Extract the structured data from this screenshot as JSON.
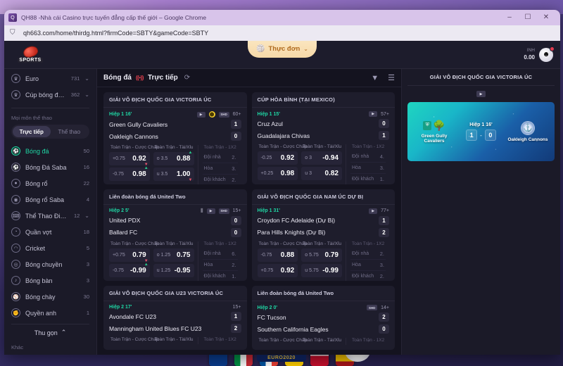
{
  "window": {
    "title": "QH88 -Nhà cái Casino trực tuyến đẳng cấp thế giới – Google Chrome",
    "favicon_icon": "site-favicon",
    "minimize_icon": "–",
    "maximize_icon": "☐",
    "close_icon": "✕",
    "address": {
      "url": "qh663.com/home/thirdg.html?firmCode=SBTY&gameCode=SBTY",
      "security_icon": "page-info-icon"
    }
  },
  "header": {
    "logo_text": "SPORTS",
    "logo_icon": "red-ball-icon",
    "menu": {
      "label": "Thực đơn",
      "icon": "menu-ball-icon",
      "caret": "⌄"
    },
    "balance": {
      "label": "INH",
      "value": "0.00",
      "avatar_icon": "user-avatar-icon",
      "notification_dot": true
    }
  },
  "sidebar": {
    "top_items": [
      {
        "label": "Euro",
        "count": "731",
        "icon": "trophy-icon",
        "caret": "⌄",
        "expandable": true
      },
      {
        "label": "Cúp bóng đá Na...",
        "count": "362",
        "icon": "trophy-icon",
        "caret": "⌄",
        "expandable": true
      }
    ],
    "section_label": "Mọi môn thể thao",
    "segmented": {
      "options": [
        "Trực tiếp",
        "Thể thao"
      ],
      "selected": "Trực tiếp"
    },
    "sports": [
      {
        "label": "Bóng đá",
        "count": "50",
        "icon": "soccer-ball-icon",
        "active": true,
        "caret": ""
      },
      {
        "label": "Bóng Đá Saba",
        "count": "16",
        "icon": "soccer-saba-icon",
        "active": false,
        "caret": ""
      },
      {
        "label": "Bóng rổ",
        "count": "22",
        "icon": "basketball-icon",
        "active": false,
        "caret": ""
      },
      {
        "label": "Bóng rổ Saba",
        "count": "4",
        "icon": "basketball-saba-icon",
        "active": false,
        "caret": ""
      },
      {
        "label": "Thể Thao Điện Tử",
        "count": "12",
        "icon": "esports-icon",
        "active": false,
        "caret": "⌄"
      },
      {
        "label": "Quần vợt",
        "count": "18",
        "icon": "tennis-icon",
        "active": false,
        "caret": ""
      },
      {
        "label": "Cricket",
        "count": "5",
        "icon": "cricket-icon",
        "active": false,
        "caret": ""
      },
      {
        "label": "Bóng chuyền",
        "count": "3",
        "icon": "volleyball-icon",
        "active": false,
        "caret": ""
      },
      {
        "label": "Bóng bàn",
        "count": "3",
        "icon": "table-tennis-icon",
        "active": false,
        "caret": ""
      },
      {
        "label": "Bóng chày",
        "count": "30",
        "icon": "baseball-icon",
        "active": false,
        "caret": ""
      },
      {
        "label": "Quyền anh",
        "count": "1",
        "icon": "boxing-icon",
        "active": false,
        "caret": ""
      }
    ],
    "collapse": {
      "label": "Thu gọn",
      "caret": "⌃"
    },
    "other_label": "Khác"
  },
  "main": {
    "title": "Bóng đá",
    "live_badge": "((•))",
    "live_label": "Trực tiếp",
    "refresh_icon": "refresh-icon",
    "filter_icon": "filter-icon",
    "list_icon": "list-view-icon",
    "odds_headers": {
      "handicap": "Toàn Trận - Cược Chấp",
      "overunder": "Toàn Trận - Tài/Xỉu",
      "onextwo": "Toàn Trận - 1X2"
    },
    "onextwo_rows": [
      "Đội nhà",
      "Hòa",
      "Đội khách"
    ],
    "matches": [
      {
        "league": "GIẢI VÔ ĐỊCH QUỐC GIA VICTORIA ÚC",
        "period": "Hiệp 1 16'",
        "time": "60+",
        "icons": [
          "tv-icon",
          "ball-icon",
          "shd-icon"
        ],
        "home": {
          "name": "Green Gully Cavaliers",
          "score": "1"
        },
        "away": {
          "name": "Oakleigh Cannons",
          "score": "0"
        },
        "handicap": [
          {
            "cap": "+0.75",
            "odds": "0.92",
            "arrow": "down"
          },
          {
            "cap": "-0.75",
            "odds": "0.98",
            "arrow": "up"
          }
        ],
        "overunder": [
          {
            "cap": "o 3.5",
            "odds": "0.88",
            "arrow": "up"
          },
          {
            "cap": "u 3.5",
            "odds": "1.00",
            "arrow": "down"
          }
        ],
        "onextwo": [
          "2.",
          "3.",
          "2."
        ]
      },
      {
        "league": "CÚP HÒA BÌNH (TẠI MEXICO)",
        "period": "Hiệp 1 15'",
        "time": "57+",
        "icons": [
          "tv-icon"
        ],
        "home": {
          "name": "Cruz Azul",
          "score": "0"
        },
        "away": {
          "name": "Guadalajara Chivas",
          "score": "1"
        },
        "handicap": [
          {
            "cap": "-0.25",
            "odds": "0.92",
            "arrow": ""
          },
          {
            "cap": "+0.25",
            "odds": "0.98",
            "arrow": ""
          }
        ],
        "overunder": [
          {
            "cap": "o 3",
            "odds": "-0.94",
            "arrow": ""
          },
          {
            "cap": "u 3",
            "odds": "0.82",
            "arrow": ""
          }
        ],
        "onextwo": [
          "4.",
          "3.",
          "1."
        ]
      },
      {
        "league": "Liên đoàn bóng đá United Two",
        "period": "Hiệp 2 5'",
        "time": "15+",
        "icons": [
          "stats-icon",
          "tv-icon",
          "shd-icon"
        ],
        "home": {
          "name": "United PDX",
          "score": "0"
        },
        "away": {
          "name": "Ballard FC",
          "score": "0"
        },
        "handicap": [
          {
            "cap": "+0.75",
            "odds": "0.79",
            "arrow": "down"
          },
          {
            "cap": "-0.75",
            "odds": "-0.99",
            "arrow": "up"
          }
        ],
        "overunder": [
          {
            "cap": "o 1.25",
            "odds": "0.75",
            "arrow": ""
          },
          {
            "cap": "u 1.25",
            "odds": "-0.95",
            "arrow": ""
          }
        ],
        "onextwo": [
          "6.",
          "2.",
          "1."
        ]
      },
      {
        "league": "GIẢI VÔ ĐỊCH QUỐC GIA NAM ÚC DỰ BỊ",
        "period": "Hiệp 1 31'",
        "time": "77+",
        "icons": [
          "tv-icon"
        ],
        "home": {
          "name": "Croydon FC Adelaide (Dự Bị)",
          "score": "1"
        },
        "away": {
          "name": "Para Hills Knights (Dự Bị)",
          "score": "2"
        },
        "handicap": [
          {
            "cap": "-0.75",
            "odds": "0.88",
            "arrow": ""
          },
          {
            "cap": "+0.75",
            "odds": "0.92",
            "arrow": ""
          }
        ],
        "overunder": [
          {
            "cap": "o 5.75",
            "odds": "0.79",
            "arrow": ""
          },
          {
            "cap": "u 5.75",
            "odds": "-0.99",
            "arrow": ""
          }
        ],
        "onextwo": [
          "2.",
          "3.",
          "2."
        ]
      },
      {
        "league": "GIẢI VÔ ĐỊCH QUỐC GIA U23 VICTORIA ÚC",
        "period": "Hiệp 2 17'",
        "time": "15+",
        "icons": [],
        "home": {
          "name": "Avondale FC U23",
          "score": "1"
        },
        "away": {
          "name": "Manningham United Blues FC U23",
          "score": "2"
        },
        "handicap": [],
        "overunder": [],
        "onextwo": []
      },
      {
        "league": "Liên đoàn bóng đá United Two",
        "period": "Hiệp 2 0'",
        "time": "14+",
        "icons": [
          "shd-icon"
        ],
        "home": {
          "name": "FC Tucson",
          "score": "2"
        },
        "away": {
          "name": "Southern California Eagles",
          "score": "0"
        },
        "handicap": [],
        "overunder": [],
        "onextwo": []
      }
    ]
  },
  "right_panel": {
    "title": "GIẢI VÔ ĐỊCH QUỐC GIA VICTORIA ÚC",
    "play_icon": "play-video-icon",
    "video": {
      "period": "Hiệp 1 16'",
      "home_name": "Green Gully Cavaliers",
      "away_name": "Oakleigh Cannons",
      "home_score": "1",
      "away_score": "0",
      "separator": "-",
      "home_crest_icon": "green-gully-crest-icon",
      "away_crest_icon": "oakleigh-crest-icon"
    }
  },
  "colors": {
    "accent_green": "#1fd6a4",
    "live_red": "#e8414f",
    "menu_gold": "#f6d9a8",
    "card_bg": "#1e1d2c",
    "page_bg": "#14131f"
  }
}
